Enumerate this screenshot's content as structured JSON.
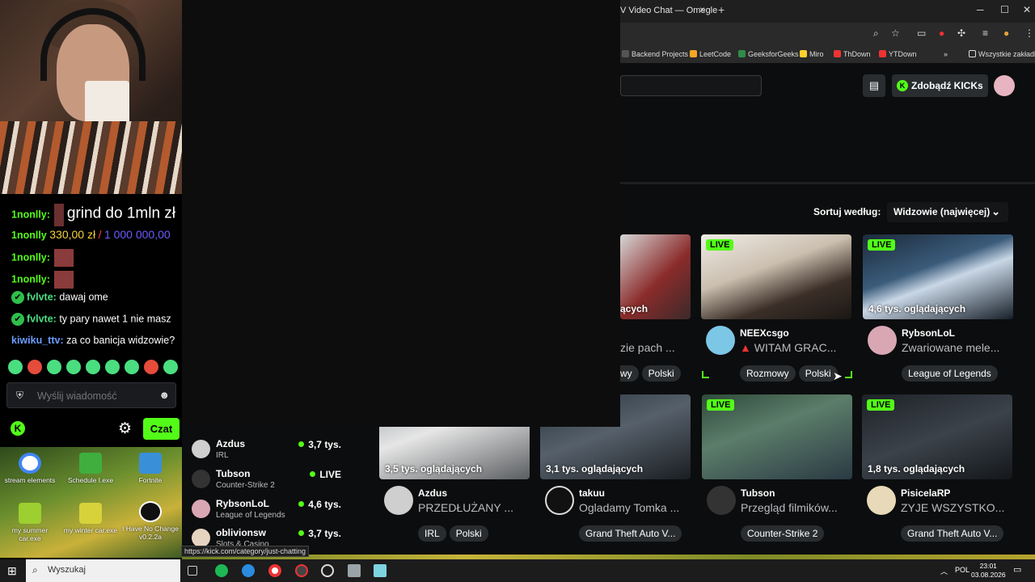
{
  "browser": {
    "tab_title": "V Video Chat — Omegle",
    "tab_close": "×",
    "new_tab": "+",
    "bookmarks": [
      "Backend Projects",
      "LeetCode",
      "GeeksforGeeks",
      "Miro",
      "ThDown",
      "YTDown",
      "Wszystkie zakładki"
    ],
    "bookmarks_more": "»"
  },
  "header": {
    "kicks_label": "Zdobądź KICKs"
  },
  "sort": {
    "label": "Sortuj według:",
    "value": "Widzowie (najwięcej)"
  },
  "chat": {
    "messages": [
      {
        "user": "1nonlly",
        "text": "grind do 1mln zł"
      },
      {
        "user": "1nonlly",
        "goal_current": "330,00 zł",
        "goal_sep": "/",
        "goal_target": "1 000 000,00"
      },
      {
        "user": "1nonlly",
        "text": ""
      },
      {
        "user": "1nonlly",
        "text": ""
      },
      {
        "user": "fvlvte",
        "text": "dawaj ome"
      },
      {
        "user": "fvlvte",
        "text": "ty pary nawet 1 nie masz"
      },
      {
        "user": "kiwiku_ttv",
        "text": "za co banicja widzowie?"
      }
    ],
    "input_placeholder": "Wyślij wiadomość",
    "send_label": "Czat"
  },
  "desktop_icons": [
    {
      "label": "stream elements"
    },
    {
      "label": "Schedule I.exe"
    },
    {
      "label": "Fortnite"
    },
    {
      "label": "my summer car.exe"
    },
    {
      "label": "my winter car.exe"
    },
    {
      "label": "I Have No Change v0.2.2a"
    }
  ],
  "sidebar_categories": [
    {
      "name": "Azdus",
      "sub": "IRL",
      "count": "3,7 tys."
    },
    {
      "name": "Tubson",
      "sub": "Counter-Strike 2",
      "count": "LIVE"
    },
    {
      "name": "RybsonLoL",
      "sub": "League of Legends",
      "count": "4,6 tys."
    },
    {
      "name": "oblivionsw",
      "sub": "Slots & Casino",
      "count": "3,7 tys."
    }
  ],
  "streams_row1": [
    {
      "viewers": "ących",
      "title": "zie pach ...",
      "tags": [
        "wy",
        "Polski"
      ]
    },
    {
      "live": "LIVE",
      "name": "NEEXcsgo",
      "title": "WITAM GRAC...",
      "tags": [
        "Rozmowy",
        "Polski"
      ]
    },
    {
      "live": "LIVE",
      "viewers": "4,6 tys. oglądających",
      "name": "RybsonLoL",
      "title": "Zwariowane mele...",
      "tags": [
        "League of Legends"
      ]
    }
  ],
  "streams_row2": [
    {
      "viewers": "3,5 tys. oglądających",
      "name": "Azdus",
      "title": "PRZEDŁUŻANY ...",
      "tags": [
        "IRL",
        "Polski"
      ]
    },
    {
      "viewers": "3,1 tys. oglądających",
      "name": "takuu",
      "title": "Ogladamy Tomka ...",
      "tags": [
        "Grand Theft Auto V..."
      ]
    },
    {
      "live": "LIVE",
      "viewers": "",
      "name": "Tubson",
      "title": "Przegląd filmików...",
      "tags": [
        "Counter-Strike 2"
      ]
    },
    {
      "live": "LIVE",
      "viewers": "1,8 tys. oglądających",
      "name": "PisicelaRP",
      "title": "ZYJE WSZYSTKO...",
      "tags": [
        "Grand Theft Auto V..."
      ]
    }
  ],
  "status_url": "https://kick.com/category/just-chatting",
  "taskbar": {
    "search_placeholder": "Wyszukaj",
    "lang": "POL",
    "time": "23:01",
    "date": "03.08.2026"
  }
}
